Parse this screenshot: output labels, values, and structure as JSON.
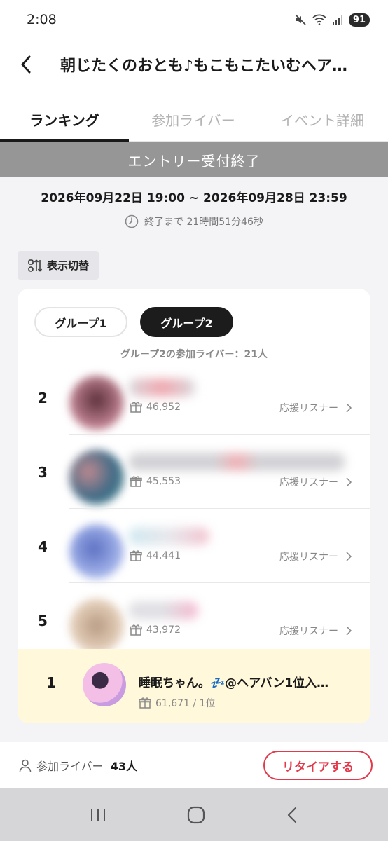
{
  "status_bar": {
    "time": "2:08",
    "battery": "91"
  },
  "header": {
    "title": "朝じたくのおとも♪もこもこたいむヘア…"
  },
  "tabs": [
    {
      "label": "ランキング",
      "active": true
    },
    {
      "label": "参加ライバー",
      "active": false
    },
    {
      "label": "イベント詳細",
      "active": false
    }
  ],
  "banner": {
    "text": "エントリー受付終了"
  },
  "event": {
    "date_range": "2026年09月22日 19:00 ~ 2026年09月28日 23:59",
    "remaining": "終了まで 21時間51分46秒"
  },
  "view_toggle": {
    "label": "表示切替"
  },
  "groups": {
    "group1": "グループ1",
    "group2": "グループ2",
    "active": "グループ2",
    "count_text": "グループ2の参加ライバー：21人"
  },
  "rankings": [
    {
      "rank": "2",
      "points": "46,952",
      "support": "応援リスナー",
      "avatar_color": "#6b3b4a",
      "name_color": "#e6b3b8"
    },
    {
      "rank": "3",
      "points": "45,553",
      "support": "応援リスナー",
      "avatar_color": "#4a6e8a",
      "name_color": "#c9c9cf"
    },
    {
      "rank": "4",
      "points": "44,441",
      "support": "応援リスナー",
      "avatar_color": "#6c7fc9",
      "name_color": "#c7e4ef"
    },
    {
      "rank": "5",
      "points": "43,972",
      "support": "応援リスナー",
      "avatar_color": "#c9b29a",
      "name_color": "#e5c4d8"
    }
  ],
  "self": {
    "rank": "1",
    "name": "睡眠ちゃん。💤@ヘアバン1位入…",
    "points": "61,671 / 1位"
  },
  "footer": {
    "participants_label": "参加ライバー",
    "participants_count": "43人",
    "retire_label": "リタイアする"
  },
  "colors": {
    "accent_red": "#e2394b",
    "banner_gray": "#969696",
    "self_row_bg": "#fff8db"
  },
  "icons": [
    "back-icon",
    "clock-icon",
    "switch-icon",
    "gift-icon",
    "chevron-right-icon",
    "person-icon",
    "recents-icon",
    "home-icon",
    "nav-back-icon"
  ]
}
